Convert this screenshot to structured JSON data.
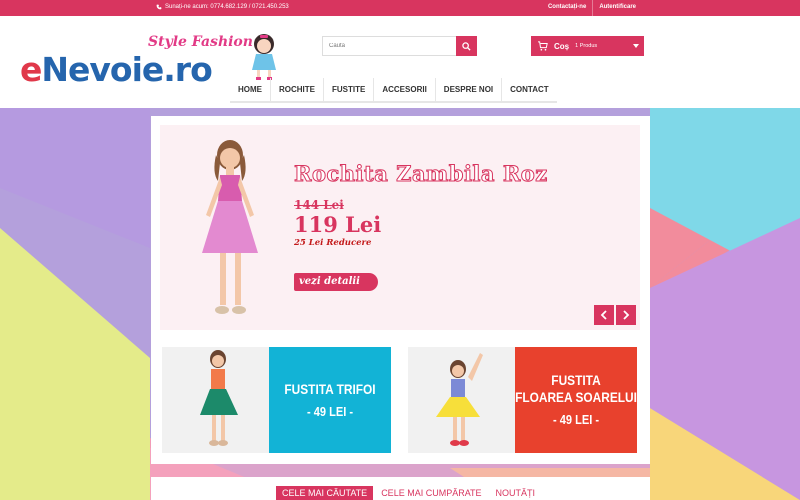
{
  "topbar": {
    "phone": "Sunați-ne acum: 0774.682.129 / 0721.450.253",
    "links": [
      "Contactați-ne",
      "Autentificare"
    ]
  },
  "header": {
    "logo_e": "e",
    "logo_rest": "Nevoie.ro",
    "tagline": "Style Fashion",
    "search_placeholder": "Caută",
    "cart_label": "Coș",
    "cart_count": "1 Produs"
  },
  "nav": [
    "HOME",
    "ROCHITE",
    "FUSTITE",
    "ACCESORII",
    "DESPRE NOI",
    "CONTACT"
  ],
  "slider": {
    "title": "Rochita Zambila Roz",
    "old_price": "144 Lei",
    "new_price": "119 Lei",
    "discount": "25 Lei Reducere",
    "cta": "vezi detalii"
  },
  "promos": [
    {
      "name_lines": [
        "FUSTITA TRIFOI"
      ],
      "price": "- 49 LEI -",
      "color": "#12b3d6"
    },
    {
      "name_lines": [
        "FUSTITA",
        "FLOAREA SOARELUI"
      ],
      "price": "- 49 LEI -",
      "color": "#e8412d"
    }
  ],
  "tabs": [
    "CELE MAI CĂUTATE",
    "CELE MAI CUMPĂRATE",
    "NOUTĂȚI"
  ],
  "colors": {
    "accent": "#d8355f",
    "blue": "#2565ad",
    "cyan": "#12b3d6",
    "red": "#e8412d"
  }
}
